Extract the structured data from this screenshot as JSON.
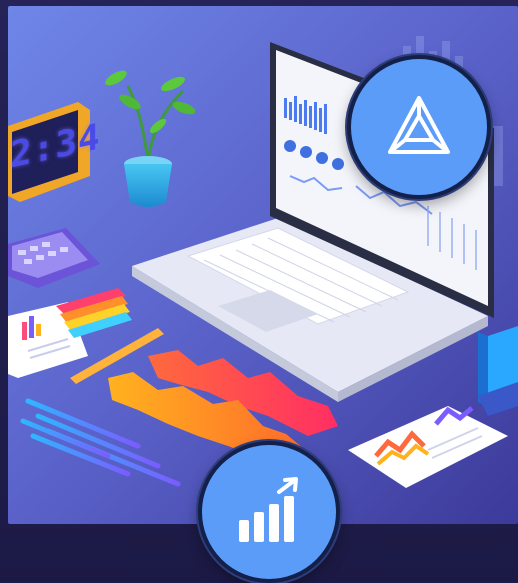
{
  "hero": {
    "clock_display": "2:34"
  },
  "badges": {
    "top_icon": "triangle-network-icon",
    "bottom_icon": "growth-chart-icon"
  },
  "colors": {
    "badge_fill": "#5b9cf8",
    "badge_border": "#13204a",
    "page_background": "#1d1b47"
  }
}
